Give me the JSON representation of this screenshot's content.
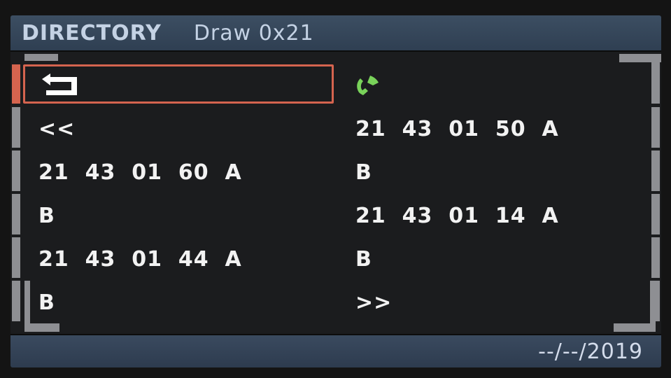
{
  "header": {
    "title": "DIRECTORY",
    "subtitle": "Draw 0x21"
  },
  "back_icon": "back-return-icon",
  "phone_icon": "phone-handset-icon",
  "colors": {
    "header_bg": "#34465a",
    "selection": "#d5644f",
    "phone_icon": "#79d25a",
    "text": "#f2f2f2"
  },
  "left_column": [
    "<<",
    "21  43  01  60  A",
    "B",
    "21  43  01  44  A",
    "B"
  ],
  "right_column": [
    "21  43  01  50  A",
    "B",
    "21  43  01  14  A",
    "B",
    ">>"
  ],
  "footer": {
    "date": "--/--/2019"
  }
}
